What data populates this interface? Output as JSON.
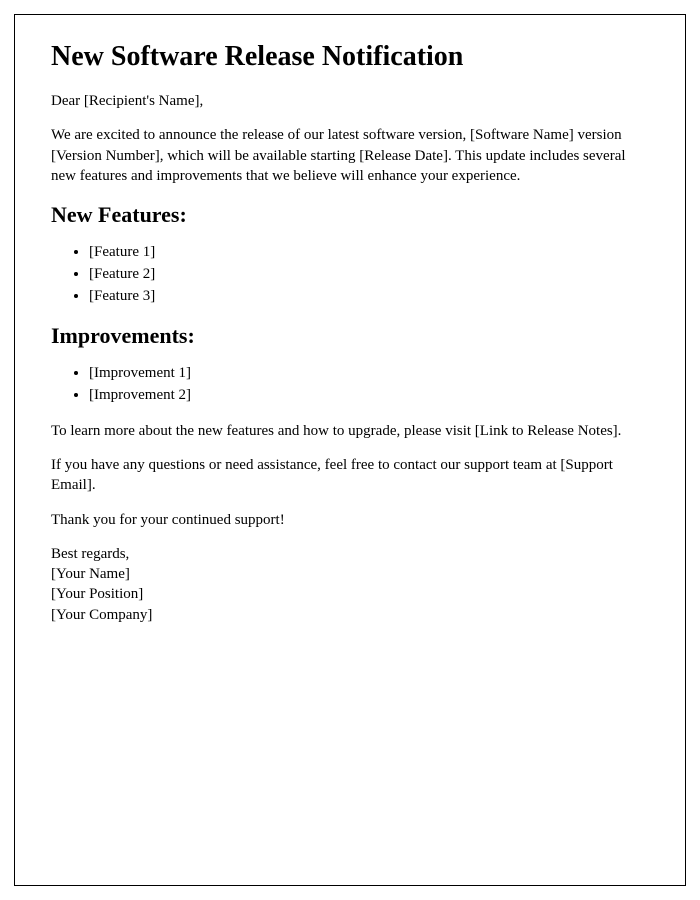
{
  "title": "New Software Release Notification",
  "greeting": "Dear [Recipient's Name],",
  "intro": "We are excited to announce the release of our latest software version, [Software Name] version [Version Number], which will be available starting [Release Date]. This update includes several new features and improvements that we believe will enhance your experience.",
  "features_heading": "New Features:",
  "features": [
    "[Feature 1]",
    "[Feature 2]",
    "[Feature 3]"
  ],
  "improvements_heading": "Improvements:",
  "improvements": [
    "[Improvement 1]",
    "[Improvement 2]"
  ],
  "learn_more": "To learn more about the new features and how to upgrade, please visit [Link to Release Notes].",
  "support": "If you have any questions or need assistance, feel free to contact our support team at [Support Email].",
  "thanks": "Thank you for your continued support!",
  "signoff": {
    "regards": "Best regards,",
    "name": "[Your Name]",
    "position": "[Your Position]",
    "company": "[Your Company]"
  }
}
